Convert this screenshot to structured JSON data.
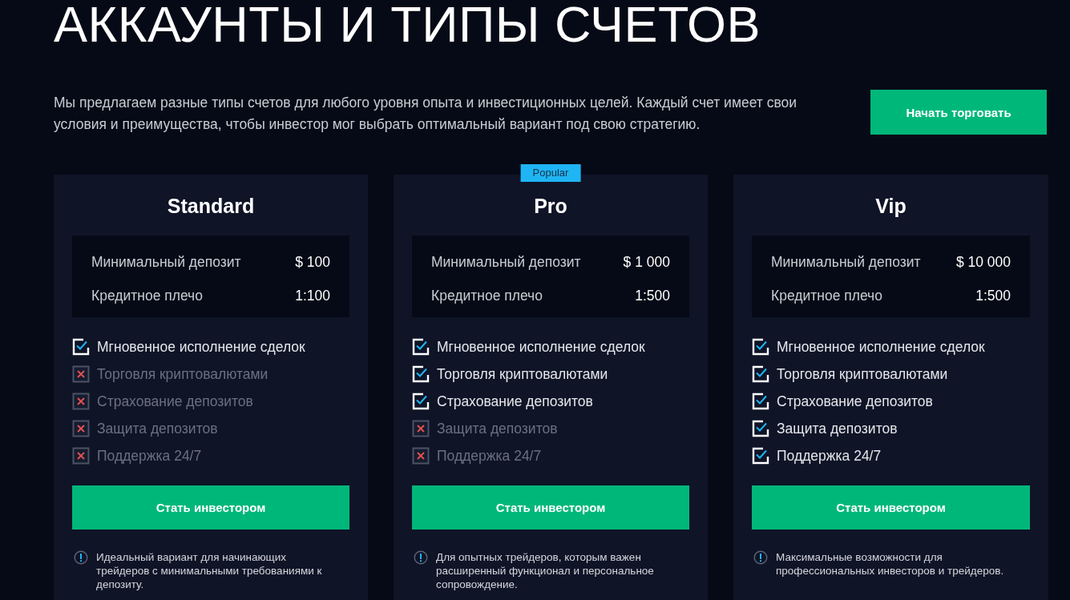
{
  "heading": "АККАУНТЫ И ТИПЫ СЧЕТОВ",
  "intro": "Мы предлагаем разные типы счетов для любого уровня опыта и инвестиционных целей. Каждый счет имеет свои условия и преимущества, чтобы инвестор мог выбрать оптимальный вариант под свою стратегию.",
  "cta": "Начать торговать",
  "cards": [
    {
      "title": "Standard",
      "terms": [
        {
          "label": "Минимальный депозит",
          "value": "$ 100"
        },
        {
          "label": "Кредитное плечо",
          "value": "1:100"
        }
      ],
      "features": [
        {
          "label": "Мгновенное исполнение сделок",
          "included": true
        },
        {
          "label": "Торговля криптовалютами",
          "included": false
        },
        {
          "label": "Страхование депозитов",
          "included": false
        },
        {
          "label": "Защита депозитов",
          "included": false
        },
        {
          "label": "Поддержка 24/7",
          "included": false
        }
      ],
      "button": "Стать инвестором",
      "note": "Идеальный вариант для начинающих трейдеров с минимальными требованиями к депозиту."
    },
    {
      "title": "Pro",
      "badge": "Popular",
      "terms": [
        {
          "label": "Минимальный депозит",
          "value": "$ 1 000"
        },
        {
          "label": "Кредитное плечо",
          "value": "1:500"
        }
      ],
      "features": [
        {
          "label": "Мгновенное исполнение сделок",
          "included": true
        },
        {
          "label": "Торговля криптовалютами",
          "included": true
        },
        {
          "label": "Страхование депозитов",
          "included": true
        },
        {
          "label": "Защита депозитов",
          "included": false
        },
        {
          "label": "Поддержка 24/7",
          "included": false
        }
      ],
      "button": "Стать инвестором",
      "note": "Для опытных трейдеров, которым важен расширенный функционал и персональное сопровождение."
    },
    {
      "title": "Vip",
      "terms": [
        {
          "label": "Минимальный депозит",
          "value": "$ 10 000"
        },
        {
          "label": "Кредитное плечо",
          "value": "1:500"
        }
      ],
      "features": [
        {
          "label": "Мгновенное исполнение сделок",
          "included": true
        },
        {
          "label": "Торговля криптовалютами",
          "included": true
        },
        {
          "label": "Страхование депозитов",
          "included": true
        },
        {
          "label": "Защита депозитов",
          "included": true
        },
        {
          "label": "Поддержка 24/7",
          "included": true
        }
      ],
      "button": "Стать инвестором",
      "note": "Максимальные возможности для профессиональных инвесторов и трейдеров."
    }
  ]
}
